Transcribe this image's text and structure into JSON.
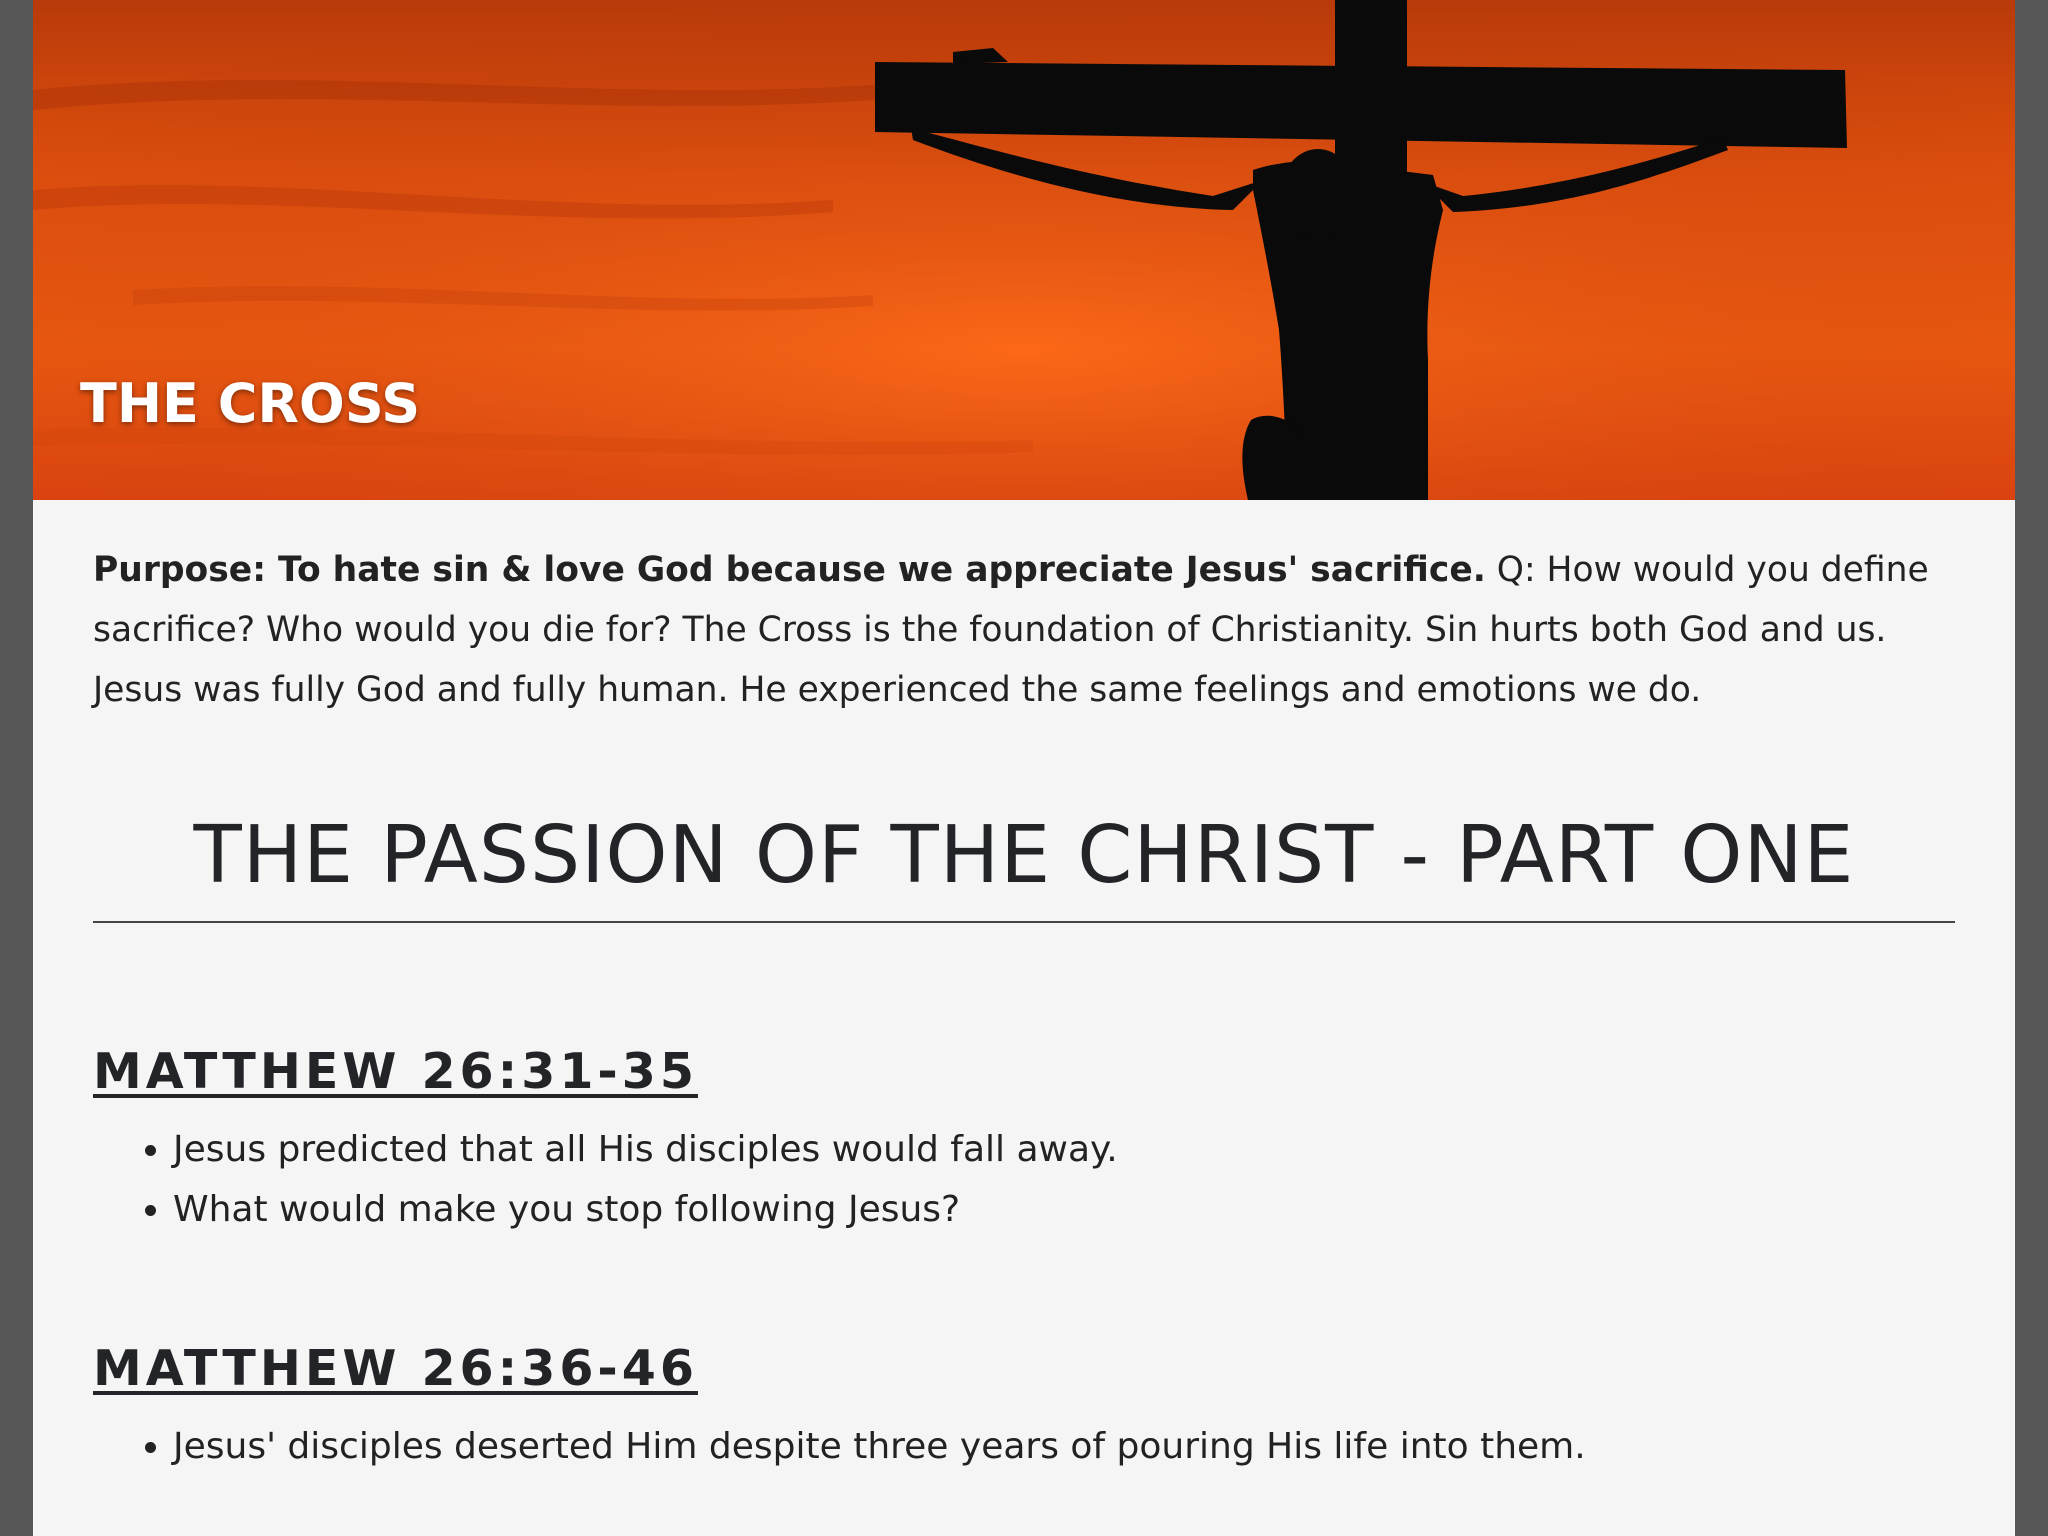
{
  "header": {
    "title": "THE CROSS",
    "image_subject": "cross-silhouette-sunset"
  },
  "intro": {
    "purpose_bold": "Purpose: To hate sin & love God because we appreciate Jesus' sacrifice.",
    "body": " Q: How would you define sacrifice? Who would you die for? The Cross is the foundation of Christianity. Sin hurts both God and us. Jesus was fully God and fully human. He experienced the same feelings and emotions we do."
  },
  "section": {
    "title": "THE PASSION OF THE CHRIST - PART ONE"
  },
  "passages": [
    {
      "reference": "MATTHEW 26:31-35",
      "points": [
        "Jesus predicted that all His disciples would fall away.",
        "What would make you stop following Jesus?"
      ]
    },
    {
      "reference": "MATTHEW 26:36-46",
      "points": [
        "Jesus' disciples deserted Him despite three years of pouring His life into them."
      ]
    }
  ],
  "colors": {
    "page_background": "#f5f5f5",
    "frame": "#575757",
    "text": "#222222",
    "sky_orange": "#f25d10"
  }
}
